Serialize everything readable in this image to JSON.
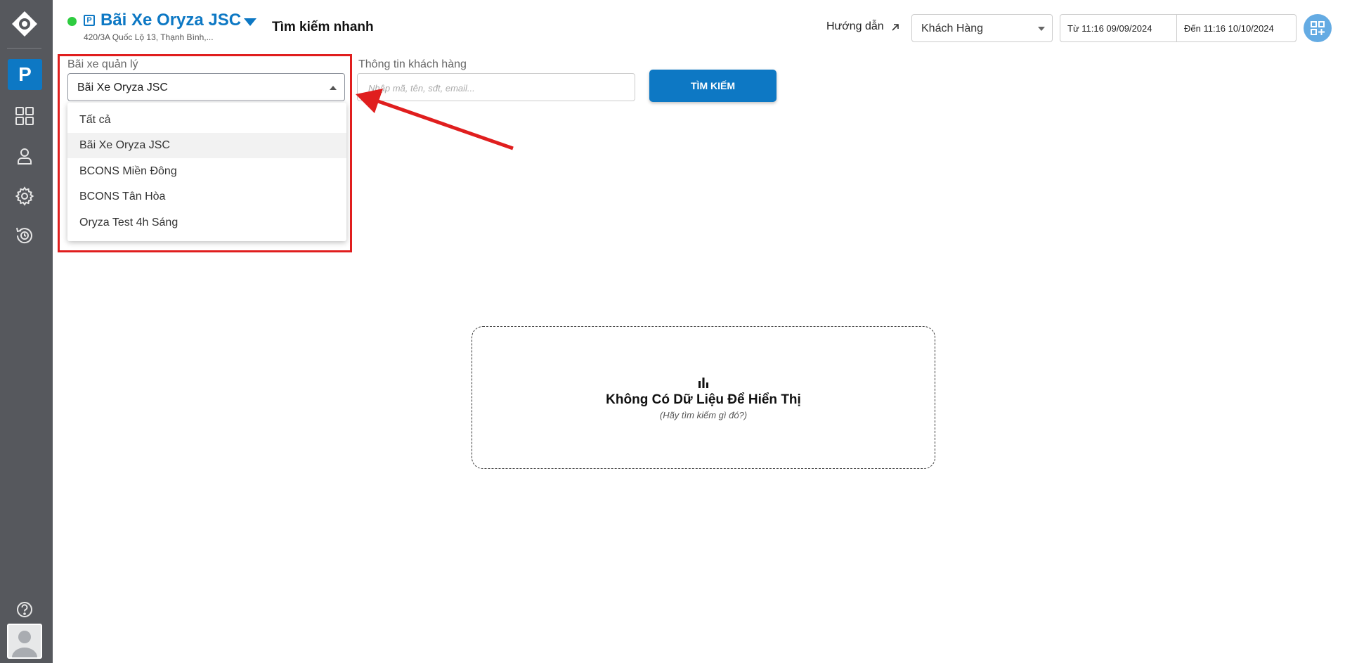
{
  "header": {
    "lot_title": "Bãi Xe Oryza JSC",
    "lot_address": "420/3A Quốc Lộ 13, Thạnh Bình,...",
    "quick_search_label": "Tìm kiếm nhanh",
    "guide_label": "Hướng dẫn",
    "customer_select_value": "Khách Hàng",
    "date_from": "Từ 11:16 09/09/2024",
    "date_to": "Đến 11:16 10/10/2024"
  },
  "sidebar": {
    "active_badge": "P"
  },
  "filters": {
    "lot_label": "Bãi xe quản lý",
    "lot_value": "Bãi Xe Oryza JSC",
    "customer_label": "Thông tin khách hàng",
    "customer_placeholder": "Nhập mã, tên, sđt, email...",
    "search_button": "TÌM KIẾM"
  },
  "dropdown": {
    "options": [
      {
        "label": "Tất cả",
        "selected": false
      },
      {
        "label": "Bãi Xe Oryza JSC",
        "selected": true
      },
      {
        "label": "BCONS Miền Đông",
        "selected": false
      },
      {
        "label": "BCONS Tân Hòa",
        "selected": false
      },
      {
        "label": "Oryza Test 4h Sáng",
        "selected": false
      }
    ]
  },
  "empty_state": {
    "title": "Không Có Dữ Liệu Để Hiển Thị",
    "subtitle": "(Hãy tìm kiếm gì đó?)"
  },
  "colors": {
    "brand": "#0d78c4",
    "sidebar": "#56585d",
    "annotation": "#e01e1e",
    "status_online": "#2ecc40"
  }
}
